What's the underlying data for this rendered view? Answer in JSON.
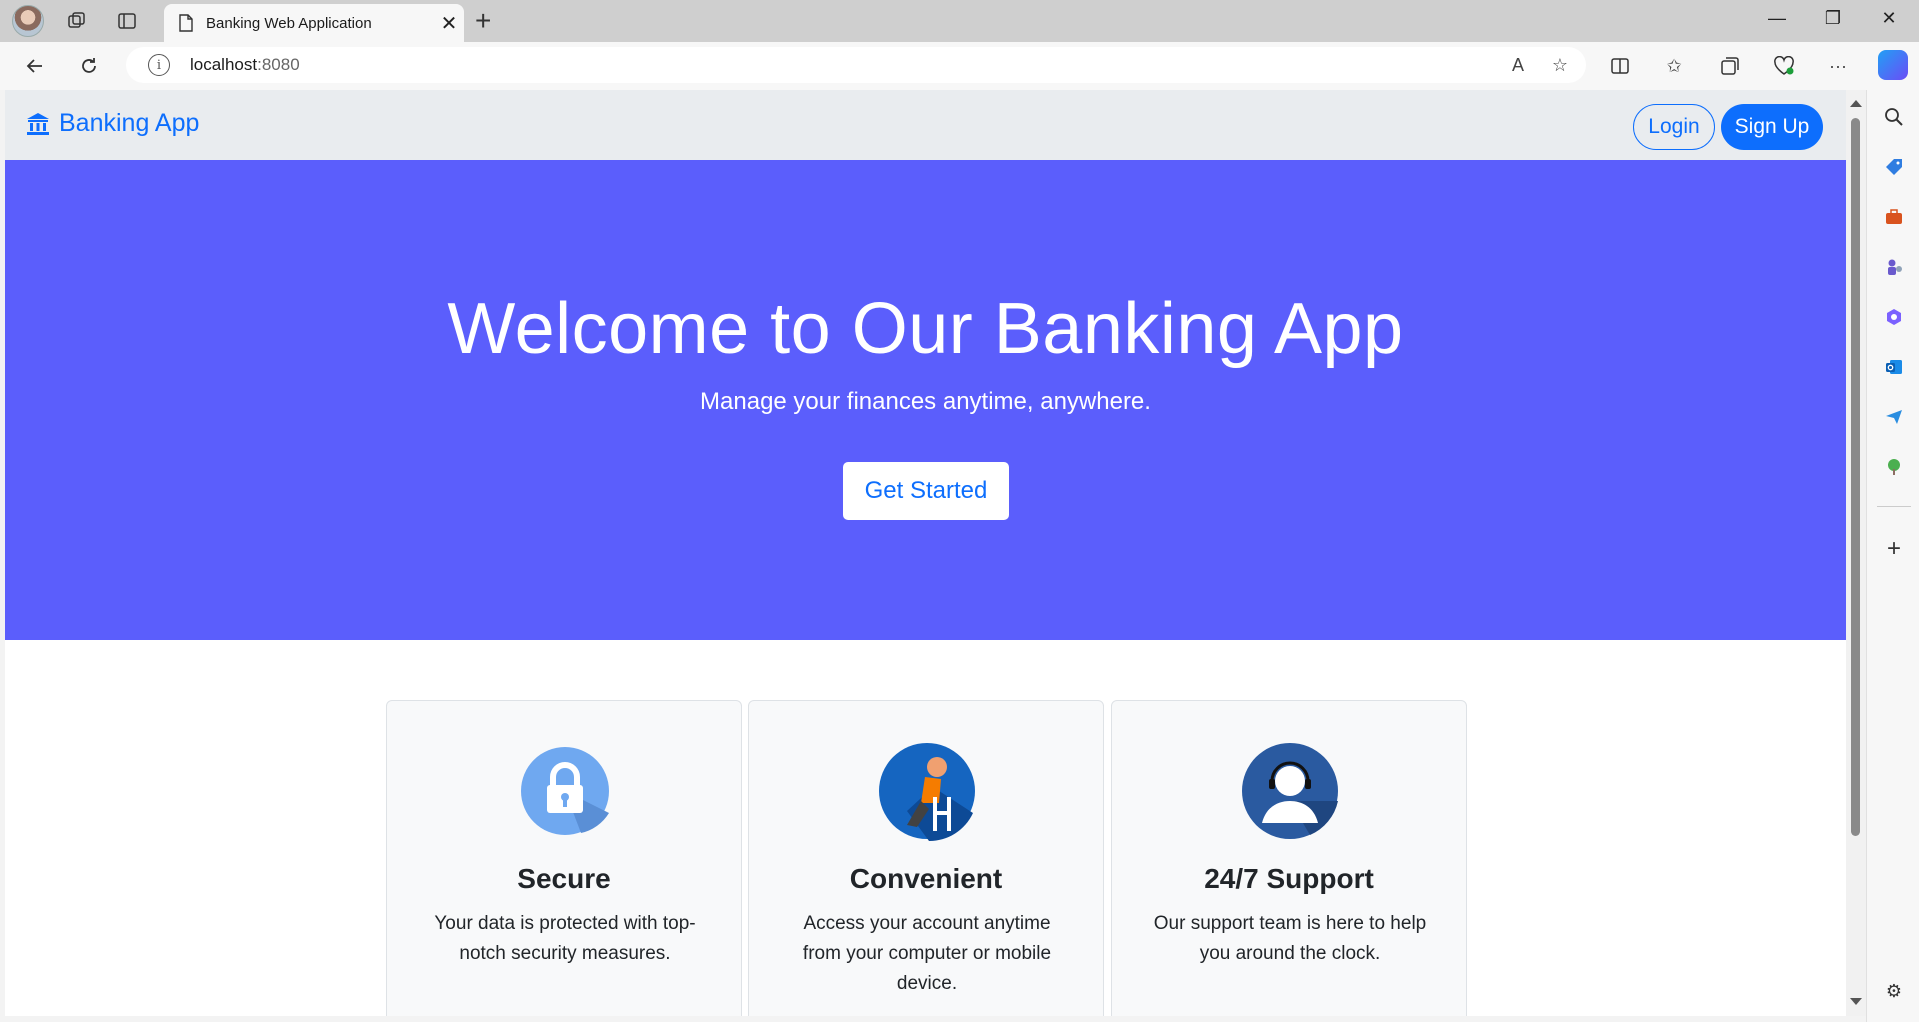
{
  "browser": {
    "tab_title": "Banking Web Application",
    "url_host": "localhost",
    "url_port": ":8080"
  },
  "navbar": {
    "brand": "Banking App",
    "login_label": "Login",
    "signup_label": "Sign Up"
  },
  "hero": {
    "title": "Welcome to Our Banking App",
    "subtitle": "Manage your finances anytime, anywhere.",
    "cta_label": "Get Started",
    "background_color": "#5b5efc"
  },
  "features": [
    {
      "title": "Secure",
      "description": "Your data is protected with top-notch security measures.",
      "icon": "lock-icon"
    },
    {
      "title": "Convenient",
      "description": "Access your account anytime from your computer or mobile device.",
      "icon": "person-relaxing-icon"
    },
    {
      "title": "24/7 Support",
      "description": "Our support team is here to help you around the clock.",
      "icon": "headset-agent-icon"
    }
  ],
  "colors": {
    "primary": "#0d6efd",
    "navbar_bg": "#e9ecef"
  }
}
